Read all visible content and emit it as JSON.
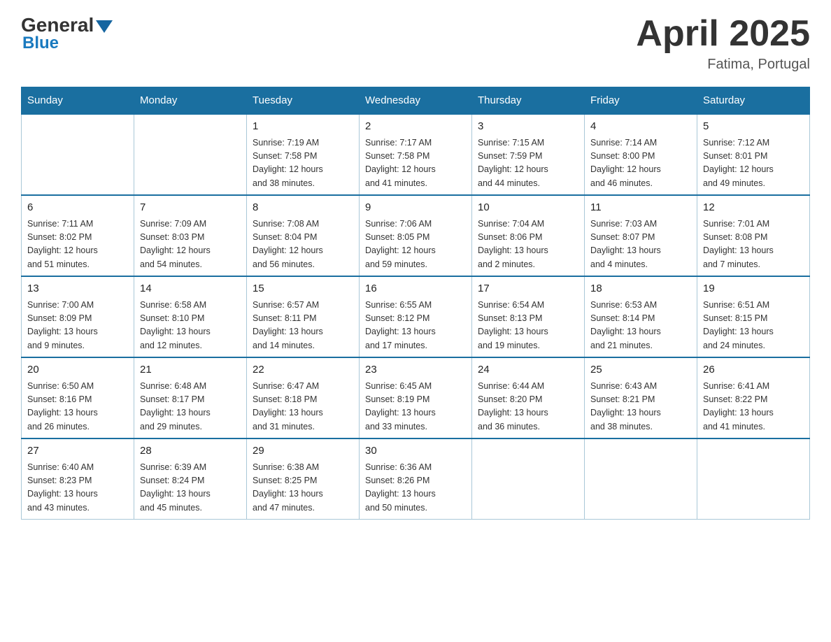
{
  "header": {
    "logo_general": "General",
    "logo_blue": "Blue",
    "title": "April 2025",
    "location": "Fatima, Portugal"
  },
  "weekdays": [
    "Sunday",
    "Monday",
    "Tuesday",
    "Wednesday",
    "Thursday",
    "Friday",
    "Saturday"
  ],
  "weeks": [
    [
      {
        "day": "",
        "info": ""
      },
      {
        "day": "",
        "info": ""
      },
      {
        "day": "1",
        "info": "Sunrise: 7:19 AM\nSunset: 7:58 PM\nDaylight: 12 hours\nand 38 minutes."
      },
      {
        "day": "2",
        "info": "Sunrise: 7:17 AM\nSunset: 7:58 PM\nDaylight: 12 hours\nand 41 minutes."
      },
      {
        "day": "3",
        "info": "Sunrise: 7:15 AM\nSunset: 7:59 PM\nDaylight: 12 hours\nand 44 minutes."
      },
      {
        "day": "4",
        "info": "Sunrise: 7:14 AM\nSunset: 8:00 PM\nDaylight: 12 hours\nand 46 minutes."
      },
      {
        "day": "5",
        "info": "Sunrise: 7:12 AM\nSunset: 8:01 PM\nDaylight: 12 hours\nand 49 minutes."
      }
    ],
    [
      {
        "day": "6",
        "info": "Sunrise: 7:11 AM\nSunset: 8:02 PM\nDaylight: 12 hours\nand 51 minutes."
      },
      {
        "day": "7",
        "info": "Sunrise: 7:09 AM\nSunset: 8:03 PM\nDaylight: 12 hours\nand 54 minutes."
      },
      {
        "day": "8",
        "info": "Sunrise: 7:08 AM\nSunset: 8:04 PM\nDaylight: 12 hours\nand 56 minutes."
      },
      {
        "day": "9",
        "info": "Sunrise: 7:06 AM\nSunset: 8:05 PM\nDaylight: 12 hours\nand 59 minutes."
      },
      {
        "day": "10",
        "info": "Sunrise: 7:04 AM\nSunset: 8:06 PM\nDaylight: 13 hours\nand 2 minutes."
      },
      {
        "day": "11",
        "info": "Sunrise: 7:03 AM\nSunset: 8:07 PM\nDaylight: 13 hours\nand 4 minutes."
      },
      {
        "day": "12",
        "info": "Sunrise: 7:01 AM\nSunset: 8:08 PM\nDaylight: 13 hours\nand 7 minutes."
      }
    ],
    [
      {
        "day": "13",
        "info": "Sunrise: 7:00 AM\nSunset: 8:09 PM\nDaylight: 13 hours\nand 9 minutes."
      },
      {
        "day": "14",
        "info": "Sunrise: 6:58 AM\nSunset: 8:10 PM\nDaylight: 13 hours\nand 12 minutes."
      },
      {
        "day": "15",
        "info": "Sunrise: 6:57 AM\nSunset: 8:11 PM\nDaylight: 13 hours\nand 14 minutes."
      },
      {
        "day": "16",
        "info": "Sunrise: 6:55 AM\nSunset: 8:12 PM\nDaylight: 13 hours\nand 17 minutes."
      },
      {
        "day": "17",
        "info": "Sunrise: 6:54 AM\nSunset: 8:13 PM\nDaylight: 13 hours\nand 19 minutes."
      },
      {
        "day": "18",
        "info": "Sunrise: 6:53 AM\nSunset: 8:14 PM\nDaylight: 13 hours\nand 21 minutes."
      },
      {
        "day": "19",
        "info": "Sunrise: 6:51 AM\nSunset: 8:15 PM\nDaylight: 13 hours\nand 24 minutes."
      }
    ],
    [
      {
        "day": "20",
        "info": "Sunrise: 6:50 AM\nSunset: 8:16 PM\nDaylight: 13 hours\nand 26 minutes."
      },
      {
        "day": "21",
        "info": "Sunrise: 6:48 AM\nSunset: 8:17 PM\nDaylight: 13 hours\nand 29 minutes."
      },
      {
        "day": "22",
        "info": "Sunrise: 6:47 AM\nSunset: 8:18 PM\nDaylight: 13 hours\nand 31 minutes."
      },
      {
        "day": "23",
        "info": "Sunrise: 6:45 AM\nSunset: 8:19 PM\nDaylight: 13 hours\nand 33 minutes."
      },
      {
        "day": "24",
        "info": "Sunrise: 6:44 AM\nSunset: 8:20 PM\nDaylight: 13 hours\nand 36 minutes."
      },
      {
        "day": "25",
        "info": "Sunrise: 6:43 AM\nSunset: 8:21 PM\nDaylight: 13 hours\nand 38 minutes."
      },
      {
        "day": "26",
        "info": "Sunrise: 6:41 AM\nSunset: 8:22 PM\nDaylight: 13 hours\nand 41 minutes."
      }
    ],
    [
      {
        "day": "27",
        "info": "Sunrise: 6:40 AM\nSunset: 8:23 PM\nDaylight: 13 hours\nand 43 minutes."
      },
      {
        "day": "28",
        "info": "Sunrise: 6:39 AM\nSunset: 8:24 PM\nDaylight: 13 hours\nand 45 minutes."
      },
      {
        "day": "29",
        "info": "Sunrise: 6:38 AM\nSunset: 8:25 PM\nDaylight: 13 hours\nand 47 minutes."
      },
      {
        "day": "30",
        "info": "Sunrise: 6:36 AM\nSunset: 8:26 PM\nDaylight: 13 hours\nand 50 minutes."
      },
      {
        "day": "",
        "info": ""
      },
      {
        "day": "",
        "info": ""
      },
      {
        "day": "",
        "info": ""
      }
    ]
  ]
}
